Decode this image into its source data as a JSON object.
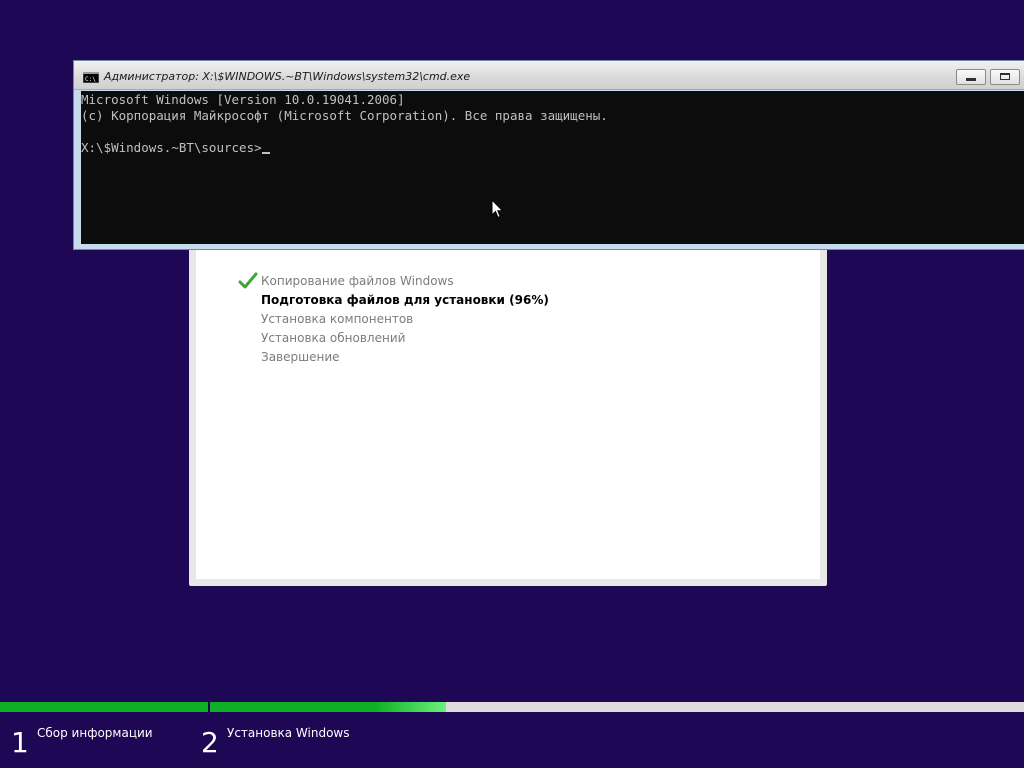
{
  "cmd_window": {
    "title": "Администратор: X:\\$WINDOWS.~BT\\Windows\\system32\\cmd.exe",
    "lines": [
      "Microsoft Windows [Version 10.0.19041.2006]",
      "(c) Корпорация Майкрософт (Microsoft Corporation). Все права защищены."
    ],
    "prompt": "X:\\$Windows.~BT\\sources>"
  },
  "setup": {
    "steps": [
      {
        "label": "Копирование файлов Windows",
        "status": "done"
      },
      {
        "label": "Подготовка файлов для установки (96%)",
        "status": "active"
      },
      {
        "label": "Установка компонентов",
        "status": "pending"
      },
      {
        "label": "Установка обновлений",
        "status": "pending"
      },
      {
        "label": "Завершение",
        "status": "pending"
      }
    ]
  },
  "phases": [
    {
      "number": "1",
      "label": "Сбор информации",
      "progress": 1.0
    },
    {
      "number": "2",
      "label": "Установка Windows",
      "progress": 0.29
    }
  ],
  "colors": {
    "desktop_background": "#1e0856",
    "progress_green": "#0fb025",
    "check_green": "#3fa53a"
  }
}
